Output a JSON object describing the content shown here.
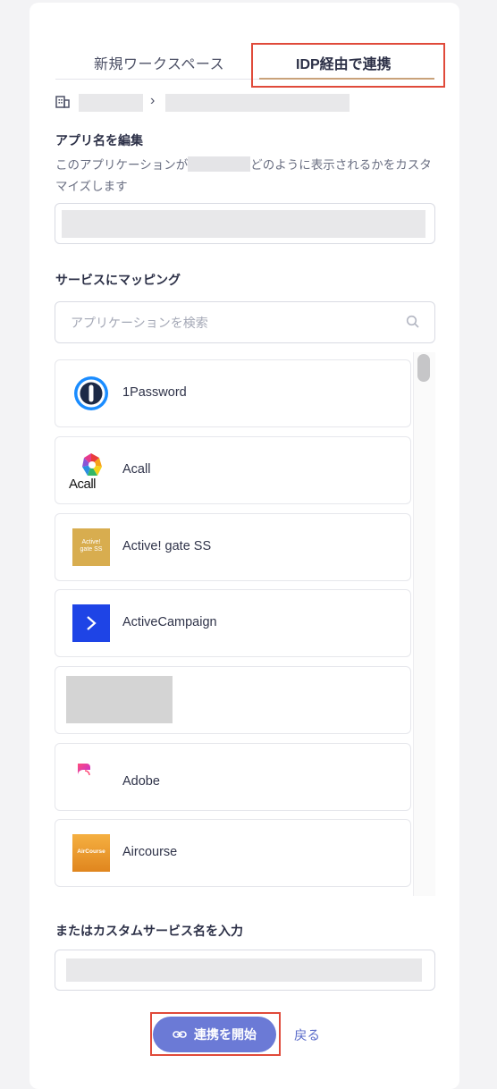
{
  "tabs": {
    "new_workspace": "新規ワークスペース",
    "idp": "IDP経由で連携"
  },
  "breadcrumb": {
    "separator": "›"
  },
  "app_name": {
    "heading": "アプリ名を編集",
    "desc_before": "このアプリケーションが",
    "desc_after": "どのように表示されるかをカスタマイズします"
  },
  "mapping": {
    "heading": "サービスにマッピング",
    "search_placeholder": "アプリケーションを検索",
    "items": [
      {
        "label": "1Password",
        "icon": "onepassword-icon"
      },
      {
        "label": "Acall",
        "icon": "acall-icon",
        "icon_text": "Acall"
      },
      {
        "label": "Active! gate SS",
        "icon": "activegate-icon",
        "icon_text": "Active!\ngate SS"
      },
      {
        "label": "ActiveCampaign",
        "icon": "activecampaign-icon"
      },
      {
        "label": "",
        "icon": "redacted"
      },
      {
        "label": "Adobe",
        "icon": "adobe-icon"
      },
      {
        "label": "Aircourse",
        "icon": "aircourse-icon",
        "icon_text": "AirCourse"
      }
    ]
  },
  "custom_service": {
    "heading": "またはカスタムサービス名を入力"
  },
  "actions": {
    "start_label": "連携を開始",
    "back_label": "戻る"
  },
  "colors": {
    "accent": "#6b7ad6",
    "highlight": "#e04a3a",
    "activecampaign": "#1e44e6",
    "activegate": "#d8ad4f",
    "aircourse": "#e89a2a"
  }
}
